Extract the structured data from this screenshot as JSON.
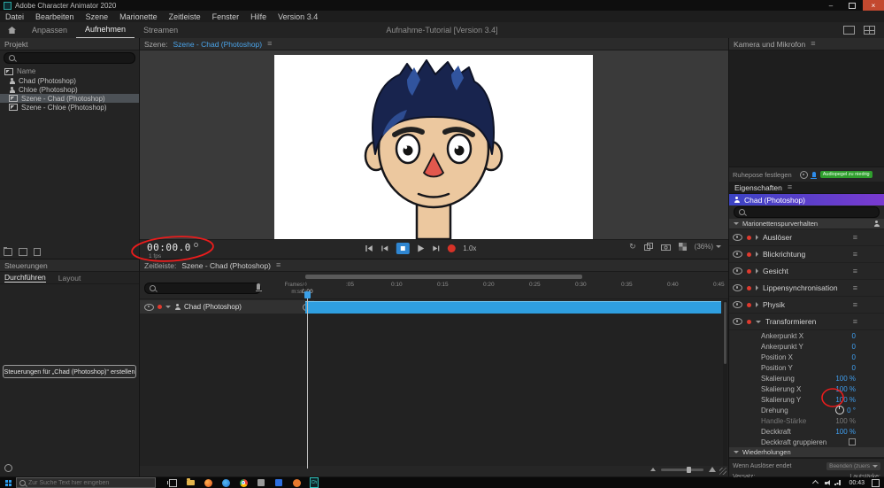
{
  "window": {
    "title": "Adobe Character Animator 2020",
    "minimize": "–",
    "close": "×"
  },
  "menubar": {
    "items": [
      "Datei",
      "Bearbeiten",
      "Szene",
      "Marionette",
      "Zeitleiste",
      "Fenster",
      "Hilfe",
      "Version 3.4"
    ]
  },
  "workspace": {
    "tabs": [
      "Anpassen",
      "Aufnehmen",
      "Streamen"
    ],
    "title": "Aufnahme-Tutorial [Version 3.4]"
  },
  "project": {
    "title": "Projekt",
    "name_header": "Name",
    "items": [
      {
        "label": "Chad (Photoshop)",
        "type": "puppet"
      },
      {
        "label": "Chloe (Photoshop)",
        "type": "puppet"
      },
      {
        "label": "Szene - Chad (Photoshop)",
        "type": "scene"
      },
      {
        "label": "Szene - Chloe (Photoshop)",
        "type": "scene"
      }
    ]
  },
  "scene": {
    "title_prefix": "Szene:",
    "title": "Szene - Chad (Photoshop)",
    "timecode": "00:00.0",
    "fps": "1 fps",
    "speed": "1.0x",
    "zoom": "(36%)"
  },
  "camera": {
    "title": "Kamera und Mikrofon",
    "rest_pose_label": "Ruhepose festlegen",
    "audio_warning": "Audiopegel zu niedrig"
  },
  "properties": {
    "tab": "Eigenschaften",
    "puppet_name": "Chad (Photoshop)",
    "section_behaviors": "Marionettenspurverhalten",
    "behaviors": [
      {
        "label": "Auslöser"
      },
      {
        "label": "Blickrichtung"
      },
      {
        "label": "Gesicht"
      },
      {
        "label": "Lippensynchronisation"
      },
      {
        "label": "Physik"
      },
      {
        "label": "Transformieren"
      }
    ],
    "transform": [
      {
        "label": "Ankerpunkt X",
        "value": "0"
      },
      {
        "label": "Ankerpunkt Y",
        "value": "0"
      },
      {
        "label": "Position X",
        "value": "0"
      },
      {
        "label": "Position Y",
        "value": "0"
      },
      {
        "label": "Skalierung",
        "value": "100 %"
      },
      {
        "label": "Skalierung X",
        "value": "100 %"
      },
      {
        "label": "Skalierung Y",
        "value": "100 %"
      },
      {
        "label": "Drehung",
        "value": "0 °"
      },
      {
        "label": "Handle-Stärke",
        "value": "100 %"
      },
      {
        "label": "Deckkraft",
        "value": "100 %"
      }
    ],
    "group_opacity_label": "Deckkraft gruppieren",
    "section_repeats": "Wiederholungen",
    "footer": {
      "trigger_end_label": "Wenn Auslöser endet",
      "trigger_end_value": "Beenden (zuers",
      "offset_label": "Versatz:",
      "volume_label": "Lautstärke:"
    }
  },
  "controls": {
    "title": "Steuerungen",
    "tabs": [
      "Durchführen",
      "Layout"
    ],
    "create_button": "Steuerungen für „Chad (Photoshop)“ erstellen"
  },
  "timeline": {
    "title_prefix": "Zeitleiste:",
    "title": "Szene - Chad (Photoshop)",
    "frames_label": "Frames",
    "mss_label": "m:ss",
    "current_time": "0:00",
    "ticks": [
      "0",
      ":05",
      "0:10",
      "0:15",
      "0:20",
      "0:25",
      "0:30",
      "0:35",
      "0:40",
      "0:45"
    ],
    "track_label": "Chad (Photoshop)"
  },
  "taskbar": {
    "search_placeholder": "Zur Suche Text hier eingeben",
    "ca_icon_label": "Ch",
    "time": "00:43"
  },
  "icons": {
    "menu": "≡"
  }
}
